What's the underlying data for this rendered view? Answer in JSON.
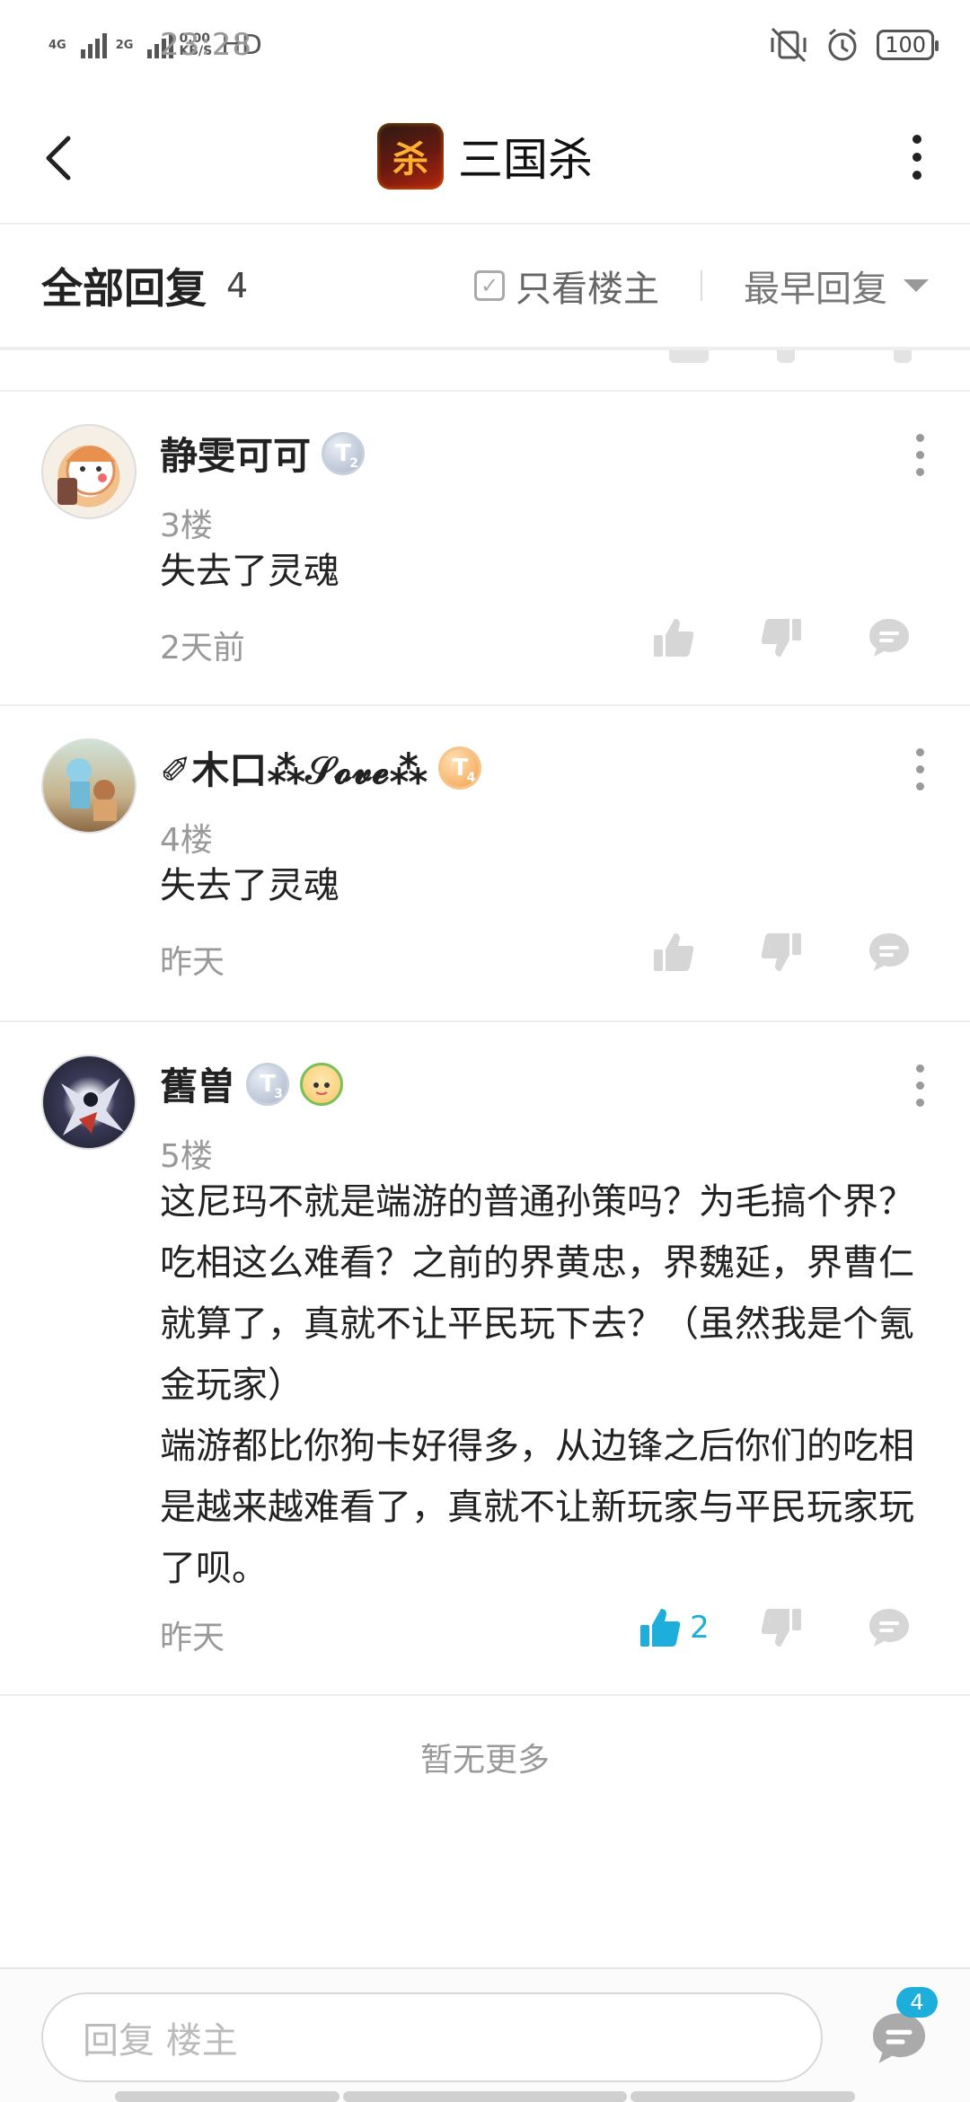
{
  "status_bar": {
    "time": "23:28",
    "net_1": "4G",
    "net_2": "2G",
    "speed_value": "0.00",
    "speed_unit": "KB/S",
    "hd": "HD",
    "battery": "100"
  },
  "header": {
    "title": "三国杀",
    "logo_glyph": "杀"
  },
  "filter": {
    "all_replies_label": "全部回复",
    "count": "4",
    "only_owner_label": "只看楼主",
    "sort_label": "最早回复"
  },
  "replies": [
    {
      "username": "静雯可可",
      "level_letter": "T",
      "level_num": "2",
      "floor": "3楼",
      "content": "失去了灵魂",
      "time": "2天前",
      "likes": ""
    },
    {
      "username": "✐木口⁂𝒮𝓸𝓿𝓮⁂",
      "level_letter": "T",
      "level_num": "4",
      "floor": "4楼",
      "content": "失去了灵魂",
      "time": "昨天",
      "likes": ""
    },
    {
      "username": "舊曽",
      "level_letter": "T",
      "level_num": "3",
      "floor": "5楼",
      "content": "这尼玛不就是端游的普通孙策吗？为毛搞个界？吃相这么难看？之前的界黄忠，界魏延，界曹仁就算了，真就不让平民玩下去？（虽然我是个氪金玩家）\n端游都比你狗卡好得多，从边锋之后你们的吃相是越来越难看了，真就不让新玩家与平民玩家玩了呗。",
      "time": "昨天",
      "likes": "2"
    }
  ],
  "no_more_text": "暂无更多",
  "bottom": {
    "input_placeholder": "回复  楼主",
    "comment_badge": "4"
  },
  "colors": {
    "accent": "#1eaedb",
    "text_secondary": "#999999",
    "divider": "#eeeeee"
  },
  "icons": [
    "back-arrow-icon",
    "more-vertical-icon",
    "checkbox-icon",
    "caret-down-icon",
    "thumbs-up-icon",
    "thumbs-down-icon",
    "comment-icon"
  ]
}
